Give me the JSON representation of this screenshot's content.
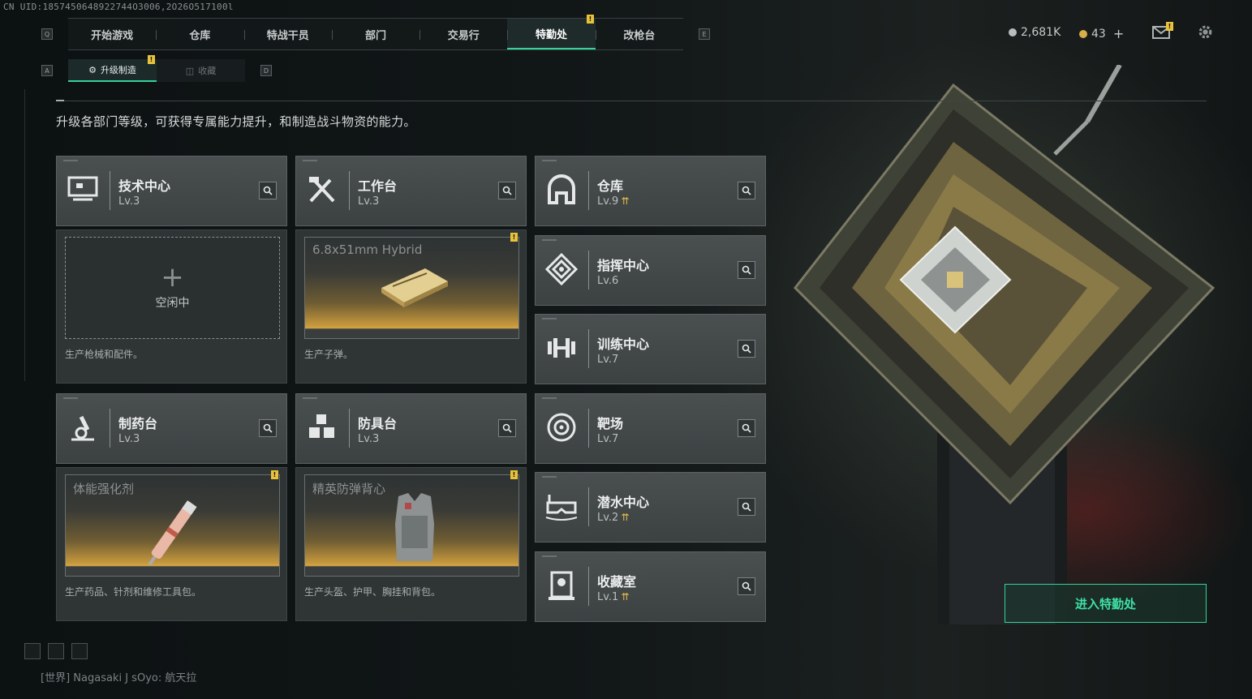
{
  "uid_text": "CN UID:1857450648922744O3006,2O26O517100l",
  "nav": {
    "key_left": "Q",
    "key_right": "E",
    "tabs": [
      {
        "label": "开始游戏"
      },
      {
        "label": "仓库"
      },
      {
        "label": "特战干员"
      },
      {
        "label": "部门"
      },
      {
        "label": "交易行"
      },
      {
        "label": "特勤处",
        "active": true
      },
      {
        "label": "改枪台"
      }
    ]
  },
  "resources": {
    "silver": "2,681K",
    "gold": "43",
    "gold_plus": "+"
  },
  "subnav": {
    "key_left": "A",
    "key_right": "D",
    "tabs": [
      {
        "label": "升级制造"
      },
      {
        "label": "收藏"
      }
    ]
  },
  "description": "升级各部门等级，可获得专属能力提升，和制造战斗物资的能力。",
  "departments": [
    {
      "name": "技术中心",
      "level": "Lv.3",
      "icon": "tech-center-icon"
    },
    {
      "name": "工作台",
      "level": "Lv.3",
      "icon": "workbench-icon"
    },
    {
      "name": "仓库",
      "level": "Lv.9",
      "icon": "warehouse-icon",
      "upgrade": true
    },
    {
      "name": "指挥中心",
      "level": "Lv.6",
      "icon": "command-center-icon"
    },
    {
      "name": "训练中心",
      "level": "Lv.7",
      "icon": "training-center-icon"
    },
    {
      "name": "制药台",
      "level": "Lv.3",
      "icon": "pharmacy-icon"
    },
    {
      "name": "防具台",
      "level": "Lv.3",
      "icon": "armor-bench-icon"
    },
    {
      "name": "靶场",
      "level": "Lv.7",
      "icon": "shooting-range-icon"
    },
    {
      "name": "潜水中心",
      "level": "Lv.2",
      "icon": "diving-center-icon",
      "upgrade": true
    },
    {
      "name": "收藏室",
      "level": "Lv.1",
      "icon": "collection-room-icon",
      "upgrade": true
    }
  ],
  "production": [
    {
      "slot_plus": "+",
      "slot_text": "空闲中",
      "caption": "生产枪械和配件。"
    },
    {
      "item_name": "6.8x51mm Hybrid",
      "caption": "生产子弹。"
    },
    {
      "item_name": "体能强化剂",
      "caption": "生产药品、针剂和维修工具包。"
    },
    {
      "item_name": "精英防弹背心",
      "caption": "生产头盔、护甲、胸挂和背包。"
    }
  ],
  "badge_mark": "!",
  "enter_button": "进入特勤处",
  "chat": {
    "channel": "[世界]",
    "text": "Nagasaki J sOyo: 航天拉"
  },
  "colors": {
    "accent": "#34d39a",
    "gold": "#e8c23a",
    "card": "#44494a"
  }
}
